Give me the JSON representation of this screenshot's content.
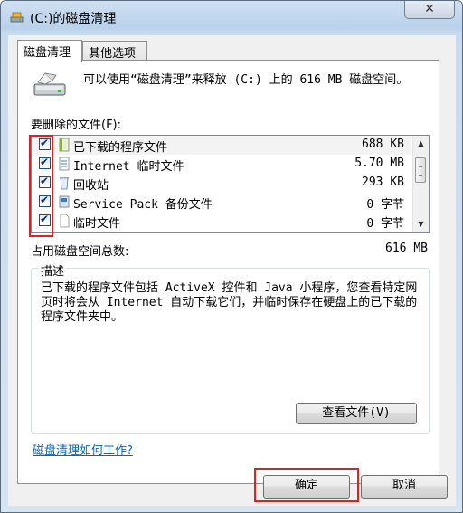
{
  "window": {
    "title": "(C:)的磁盘清理",
    "close_glyph": "✕"
  },
  "tabs": [
    {
      "label": "磁盘清理",
      "active": true
    },
    {
      "label": "其他选项",
      "active": false
    }
  ],
  "intro": {
    "text": "可以使用“磁盘清理”来释放 (C:) 上的 616 MB 磁盘空间。"
  },
  "files_label": "要删除的文件(F):",
  "files": [
    {
      "name": "已下载的程序文件",
      "size": "688 KB",
      "checked": true,
      "icon": "folder-icon"
    },
    {
      "name": "Internet 临时文件",
      "size": "5.70 MB",
      "checked": true,
      "icon": "document-icon"
    },
    {
      "name": "回收站",
      "size": "293 KB",
      "checked": true,
      "icon": "recycle-bin-icon"
    },
    {
      "name": "Service Pack 备份文件",
      "size": "0 字节",
      "checked": true,
      "icon": "installer-icon"
    },
    {
      "name": "临时文件",
      "size": "0 字节",
      "checked": true,
      "icon": "blank-file-icon"
    }
  ],
  "total": {
    "label": "占用磁盘空间总数:",
    "value": "616 MB"
  },
  "description": {
    "legend": "描述",
    "text": "已下载的程序文件包括 ActiveX 控件和 Java 小程序，您查看特定网页时将会从 Internet 自动下载它们，并临时保存在硬盘上的已下载的程序文件夹中。",
    "view_files_label": "查看文件(V)"
  },
  "help_link": "磁盘清理如何工作?",
  "buttons": {
    "ok": "确定",
    "cancel": "取消"
  },
  "colors": {
    "highlight_box": "#e0201f",
    "link": "#0066cc"
  }
}
